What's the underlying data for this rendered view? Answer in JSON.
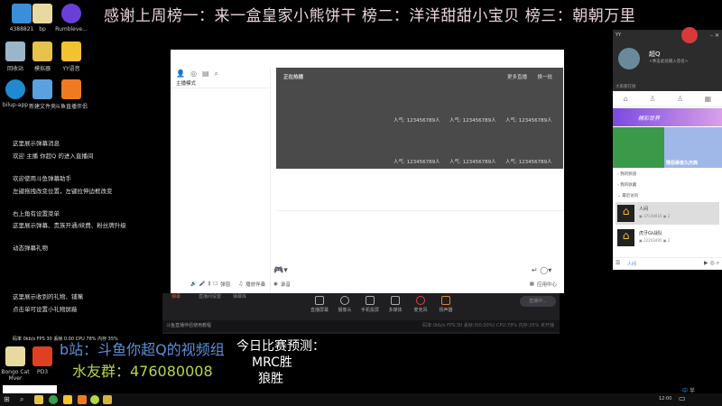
{
  "banner": "感谢上周榜一：来一盒皇家小熊饼干 榜二：洋洋甜甜小宝贝 榜三：朝朝万里",
  "desktop_icons": [
    {
      "label": "4388821",
      "color": "#3a8fd8"
    },
    {
      "label": "bp",
      "color": "#e8d9a0"
    },
    {
      "label": "Rumbleve...",
      "color": "#6a3fd8"
    },
    {
      "label": "回收站",
      "color": "#9bb6c9"
    },
    {
      "label": "模拟器",
      "color": "#e6c34a"
    },
    {
      "label": "YY语音",
      "color": "#f2c230"
    },
    {
      "label": "bilup-app",
      "color": "#1e8bd0"
    },
    {
      "label": "新建文件夹",
      "color": "#5aa1e0"
    },
    {
      "label": "斗鱼直播伴侣",
      "color": "#f07a20"
    },
    {
      "label": "Bongo Cat Mver",
      "color": "#e8d9a0"
    },
    {
      "label": "PD3",
      "color": "#e04020"
    }
  ],
  "overlay_lines": [
    "这里展示弹幕消息",
    "欢迎 主播 你超Q 的进入直播间",
    "欢迎使用斗鱼弹幕助手",
    "左键拖拽改变位置，左键拉伸边框改变",
    "右上角有设置菜单",
    "这里展示弹幕、贵族开通/续费、粉丝牌升级",
    "动态弹幕礼物",
    "这里展示收到的礼物、铺嘴",
    "点击单可设置小礼物屏蔽"
  ],
  "overlay_stats": "码率 0kb/s  FPS 30  丢帧 0.00   CPU 78%  内存 35%",
  "window": {
    "mode": "主播模式",
    "hot_title": "正在热播",
    "more": "更多直播",
    "refresh": "换一批",
    "popularity": [
      "人气: 123456789人",
      "人气: 123456789人",
      "人气: 123456789人",
      "人气: 123456789人",
      "人气: 123456789人",
      "人气: 123456789人"
    ],
    "toolbar": [
      "弹窗",
      "播放伴奏",
      "录音"
    ],
    "app_center": "应用中心"
  },
  "app": {
    "tabs": [
      "弹幕",
      "直播间设置",
      "弹幕库"
    ],
    "tools": [
      "直播屏幕",
      "摄像头",
      "手机投屏",
      "多媒体",
      "麦克风",
      "扬声器"
    ],
    "start": "直播中...",
    "notice": "斗鱼直播伴侣使用教程",
    "status": "码率:0kb/s  FPS:30  丢帧:0(0.00%)  CPU:78%  内存:35%  未开播"
  },
  "right_panel": {
    "app": "YY",
    "username": "超Q",
    "signature": "<季击此处输入签名>",
    "search_hint": "大家都在搜",
    "banner": "精彩世界",
    "banner2": "情侣缘音久庆典",
    "menu": [
      "我的频道",
      "我的收藏",
      "最近访问"
    ],
    "recent": [
      {
        "name": "人间",
        "id": "37149016",
        "count": "2"
      },
      {
        "name": "虎牙Gt战队",
        "id": "22203495",
        "count": "2"
      }
    ],
    "footer": "人间"
  },
  "bottom": {
    "bilibili": "b站：斗鱼你超Q的视频组",
    "group": "水友群：476080008",
    "prediction_title": "今日比赛预测：",
    "prediction_1": "MRC胜",
    "prediction_2": "狼胜"
  },
  "taskbar": {
    "time": "12:00",
    "ime": "中",
    "ime2": "半"
  }
}
